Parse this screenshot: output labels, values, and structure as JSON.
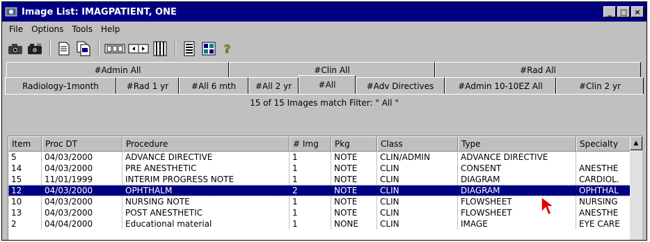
{
  "window": {
    "title": "Image List: IMAGPATIENT, ONE",
    "controls": {
      "minimize": "_",
      "maximize": "□",
      "close": "×"
    }
  },
  "menu": [
    "File",
    "Options",
    "Tools",
    "Help"
  ],
  "toolbar": {
    "icons": [
      "camera-icon",
      "camera-alt-icon",
      "document-icon",
      "documents-icon",
      "filmstrip-icon",
      "filmstrip-nav-icon",
      "columns-icon",
      "list-icon",
      "abstract-icon",
      "help-icon"
    ]
  },
  "tabs": {
    "back_row": [
      "#Admin All",
      "#Clin All",
      "#Rad All"
    ],
    "front_row": [
      "Radiology-1month",
      "#Rad 1 yr",
      "#All 6 mth",
      "#All 2 yr",
      "#All",
      "#Adv Directives",
      "#Admin 10-10EZ All",
      "#Clin 2 yr"
    ],
    "active": "#All"
  },
  "filter_text": "15 of 15 Images match Filter: \" All \"",
  "table": {
    "columns": [
      "Item",
      "Proc DT",
      "Procedure",
      "# Img",
      "Pkg",
      "Class",
      "Type",
      "Specialty"
    ],
    "rows": [
      [
        "5",
        "04/03/2000",
        "ADVANCE DIRECTIVE",
        "1",
        "NOTE",
        "CLIN/ADMIN",
        "ADVANCE DIRECTIVE",
        ""
      ],
      [
        "14",
        "04/03/2000",
        "PRE ANESTHETIC",
        "1",
        "NOTE",
        "CLIN",
        "CONSENT",
        "ANESTHE"
      ],
      [
        "15",
        "11/01/1999",
        "INTERIM PROGRESS NOTE",
        "1",
        "NOTE",
        "CLIN",
        "DIAGRAM",
        "CARDIOL."
      ],
      [
        "12",
        "04/03/2000",
        "OPHTHALM",
        "2",
        "NOTE",
        "CLIN",
        "DIAGRAM",
        "OPHTHAL"
      ],
      [
        "10",
        "04/03/2000",
        "NURSING NOTE",
        "1",
        "NOTE",
        "CLIN",
        "FLOWSHEET",
        "NURSING"
      ],
      [
        "13",
        "04/03/2000",
        "POST ANESTHETIC",
        "1",
        "NOTE",
        "CLIN",
        "FLOWSHEET",
        "ANESTHE"
      ],
      [
        "2",
        "04/04/2000",
        "Educational material",
        "1",
        "NONE",
        "CLIN",
        "IMAGE",
        "EYE CARE"
      ]
    ],
    "selected_row": 3
  },
  "colors": {
    "titlebar": "#000080",
    "chrome": "#c0c0c0",
    "selection": "#000080"
  }
}
